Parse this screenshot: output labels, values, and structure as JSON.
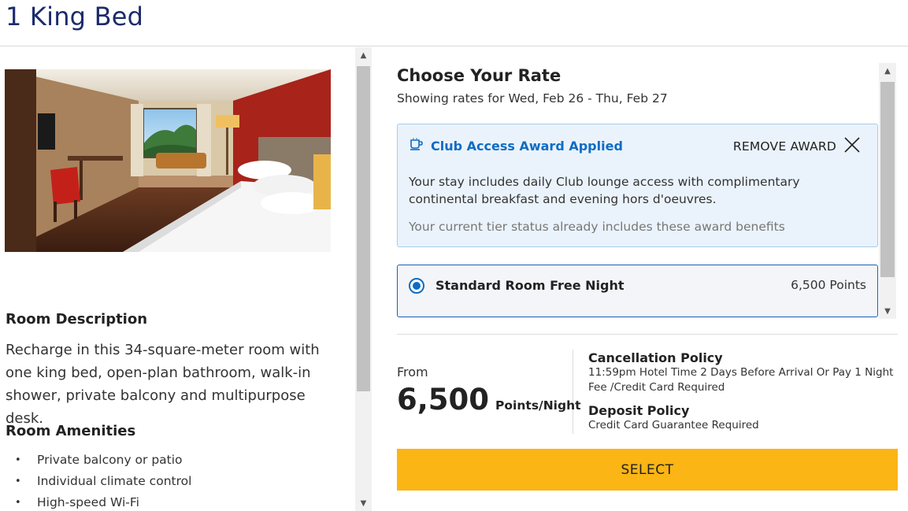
{
  "header": {
    "room_title": "1 King Bed"
  },
  "left": {
    "room_description_heading": "Room Description",
    "room_description": "Recharge in this 34-square-meter room with one king bed, open-plan bathroom, walk-in shower, private balcony and multipurpose desk.",
    "amenities_heading": "Room Amenities",
    "amenities": [
      "Private balcony or patio",
      "Individual climate control",
      "High-speed Wi-Fi"
    ]
  },
  "rates": {
    "title": "Choose Your Rate",
    "dates": "Showing rates for Wed, Feb 26 - Thu, Feb 27",
    "award": {
      "icon": "cup-icon",
      "title": "Club Access Award Applied",
      "remove_label": "REMOVE AWARD",
      "description": "Your stay includes daily Club lounge access with complimentary continental breakfast and evening hors d'oeuvres.",
      "note": "Your current tier status already includes these award benefits"
    },
    "options": [
      {
        "name": "Standard Room Free Night",
        "points": "6,500 Points",
        "selected": true
      }
    ]
  },
  "summary": {
    "from_label": "From",
    "price": "6,500",
    "unit": "Points/Night",
    "cancellation_title": "Cancellation Policy",
    "cancellation_text": "11:59pm Hotel Time 2 Days Before Arrival Or Pay 1 Night Fee /Credit Card Required",
    "deposit_title": "Deposit Policy",
    "deposit_text": "Credit Card Guarantee Required",
    "select_label": "SELECT"
  },
  "colors": {
    "title_navy": "#1c2b6b",
    "award_blue": "#0e6cc4",
    "award_bg": "#eaf3fb",
    "select_yellow": "#fbb514"
  }
}
